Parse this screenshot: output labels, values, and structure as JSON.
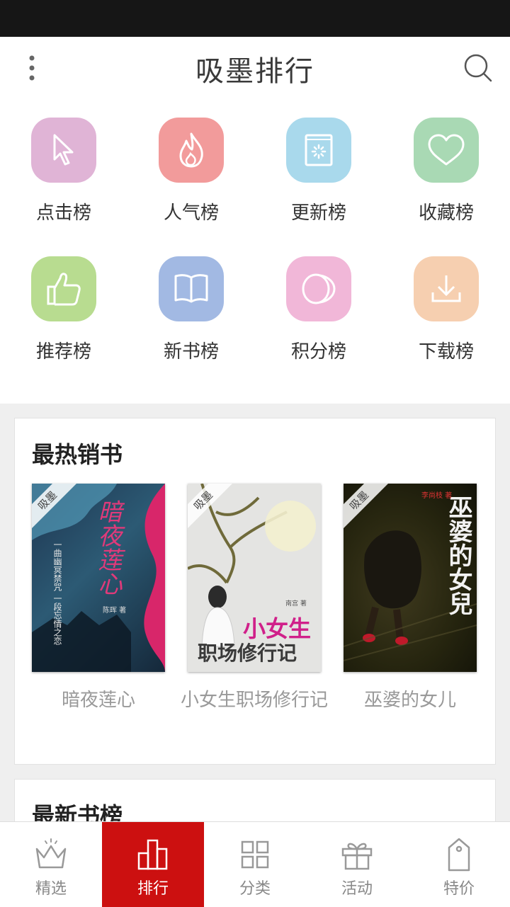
{
  "header": {
    "title": "吸墨排行"
  },
  "rank_categories": [
    {
      "label": "点击榜",
      "icon": "cursor-icon",
      "color": "#e0b4d6"
    },
    {
      "label": "人气榜",
      "icon": "flame-icon",
      "color": "#f29b9b"
    },
    {
      "label": "更新榜",
      "icon": "refresh-book-icon",
      "color": "#a9d9ec"
    },
    {
      "label": "收藏榜",
      "icon": "heart-icon",
      "color": "#a9d9b4"
    },
    {
      "label": "推荐榜",
      "icon": "thumbs-up-icon",
      "color": "#b8dc90"
    },
    {
      "label": "新书榜",
      "icon": "open-book-icon",
      "color": "#a2b9e3"
    },
    {
      "label": "积分榜",
      "icon": "coins-icon",
      "color": "#f1b7d8"
    },
    {
      "label": "下载榜",
      "icon": "download-icon",
      "color": "#f6cfb0"
    }
  ],
  "hot_books": {
    "title": "最热销书",
    "badge": "吸墨",
    "books": [
      {
        "title": "暗夜莲心",
        "cover_title": "暗夜莲心",
        "cover_subtitle": "一曲幽冥禁咒 一段忘情之恋",
        "cover_author": "陈晖 著"
      },
      {
        "title": "小女生职场修行记",
        "cover_title_1": "小女生",
        "cover_title_2": "职场修行记",
        "cover_author": "南宫 著"
      },
      {
        "title": "巫婆的女儿",
        "cover_title": "巫婆的女兒",
        "cover_author": "李尚枝 著"
      }
    ]
  },
  "new_books": {
    "title": "最新书榜"
  },
  "tabs": [
    {
      "label": "精选",
      "icon": "crown-icon",
      "active": false
    },
    {
      "label": "排行",
      "icon": "bar-chart-icon",
      "active": true
    },
    {
      "label": "分类",
      "icon": "grid-icon",
      "active": false
    },
    {
      "label": "活动",
      "icon": "gift-icon",
      "active": false
    },
    {
      "label": "特价",
      "icon": "price-tag-icon",
      "active": false
    }
  ],
  "colors": {
    "accent": "#cc1010",
    "status_bar": "#161616"
  }
}
